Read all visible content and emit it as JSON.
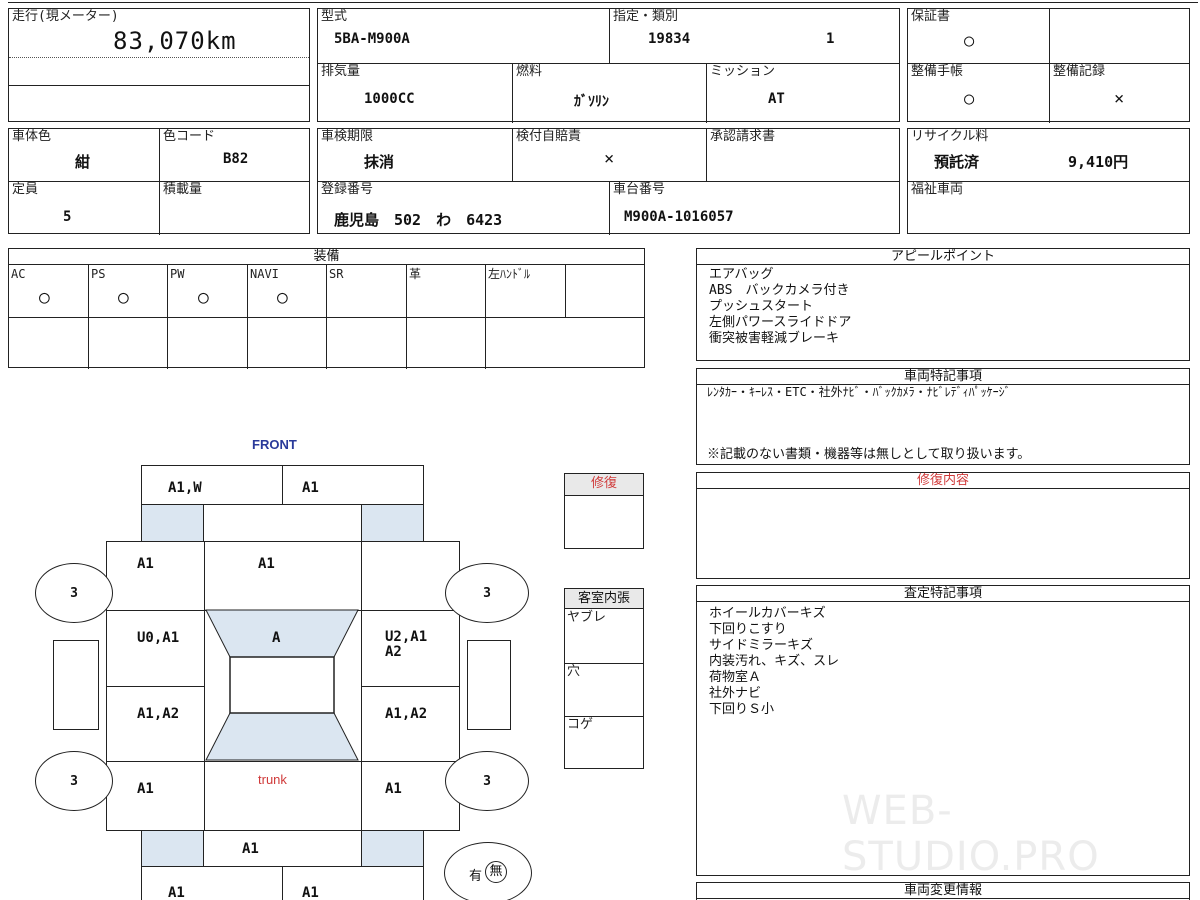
{
  "mileage": {
    "label": "走行(現メーター)",
    "value": "83,070km"
  },
  "model": {
    "label": "型式",
    "value": "5BA-M900A"
  },
  "designation": {
    "label": "指定・類別",
    "designation": "19834",
    "category": "1"
  },
  "warranty": {
    "label": "保証書",
    "value": "○"
  },
  "displacement": {
    "label": "排気量",
    "value": "1000CC"
  },
  "fuel": {
    "label": "燃料",
    "value": "ｶﾞｿﾘﾝ"
  },
  "transmission": {
    "label": "ミッション",
    "value": "AT"
  },
  "maintenance_book": {
    "label": "整備手帳",
    "value": "○"
  },
  "maintenance_record": {
    "label": "整備記録",
    "value": "×"
  },
  "body_color": {
    "label": "車体色",
    "value": "紺"
  },
  "color_code": {
    "label": "色コード",
    "value": "B82"
  },
  "inspection_expiry": {
    "label": "車検期限",
    "value": "抹消"
  },
  "liability_insurance": {
    "label": "検付自賠責",
    "value": "×"
  },
  "approval_request": {
    "label": "承認請求書",
    "value": ""
  },
  "recycle_fee": {
    "label": "リサイクル料",
    "status": "預託済",
    "amount": "9,410円"
  },
  "capacity": {
    "label": "定員",
    "value": "5"
  },
  "load_capacity": {
    "label": "積載量",
    "value": ""
  },
  "registration": {
    "label": "登録番号",
    "value": "鹿児島　502　わ　6423"
  },
  "chassis": {
    "label": "車台番号",
    "value": "M900A-1016057"
  },
  "welfare": {
    "label": "福祉車両",
    "value": ""
  },
  "equipment": {
    "title": "装備",
    "items": [
      {
        "name": "AC",
        "value": "○"
      },
      {
        "name": "PS",
        "value": "○"
      },
      {
        "name": "PW",
        "value": "○"
      },
      {
        "name": "NAVI",
        "value": "○"
      },
      {
        "name": "SR",
        "value": ""
      },
      {
        "name": "革",
        "value": ""
      },
      {
        "name": "左ﾊﾝﾄﾞﾙ",
        "value": ""
      }
    ]
  },
  "appeal": {
    "title": "アピールポイント",
    "lines": [
      "エアバッグ",
      "ABS　バックカメラ付き",
      "プッシュスタート",
      "左側パワースライドドア",
      "衝突被害軽減ブレーキ"
    ]
  },
  "vehicle_notes": {
    "title": "車両特記事項",
    "line": "ﾚﾝﾀｶｰ・ｷｰﾚｽ・ETC・社外ﾅﾋﾞ・ﾊﾞｯｸｶﾒﾗ・ﾅﾋﾞﾚﾃﾞｨﾊﾟｯｹｰｼﾞ",
    "footer": "※記載のない書類・機器等は無しとして取り扱います。"
  },
  "repair_contents": {
    "title": "修復内容"
  },
  "assessment": {
    "title": "査定特記事項",
    "lines": [
      "ホイールカバーキズ",
      "下回りこすり",
      "サイドミラーキズ",
      "内装汚れ、キズ、スレ",
      "荷物室Ａ",
      "社外ナビ",
      "下回りＳ小"
    ]
  },
  "vehicle_change": {
    "title": "車両変更情報"
  },
  "repair_box": {
    "title": "修復"
  },
  "interior": {
    "title": "客室内張",
    "rows": [
      "ヤブレ",
      "穴",
      "コゲ"
    ]
  },
  "diagram": {
    "front": "FRONT",
    "trunk": "trunk",
    "grades": {
      "bumper_front_left": "A1,W",
      "bumper_front_right": "A1",
      "fender_left": "A1",
      "hood": "A1",
      "door_front_left": "U0,A1",
      "roof": "A",
      "door_front_right": "U2,A1",
      "door_front_right_2": "A2",
      "door_rear_left": "A1,A2",
      "door_rear_right": "A1,A2",
      "quarter_left": "A1",
      "quarter_right": "A1",
      "back": "A1",
      "bumper_rear_left": "A1",
      "bumper_rear_right": "A1"
    },
    "tires": [
      "3",
      "3",
      "3",
      "3"
    ],
    "spare": {
      "label": "有",
      "selected": "無"
    }
  },
  "watermark": "WEB-STUDIO.PRO"
}
